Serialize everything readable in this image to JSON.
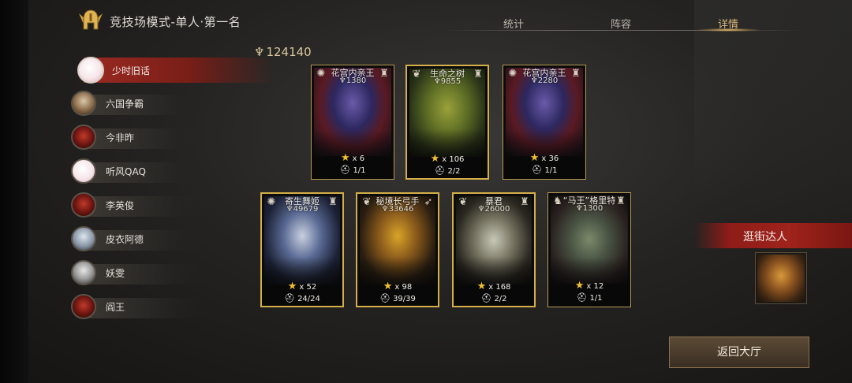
{
  "header": {
    "title": "竞技场模式-单人·第一名",
    "tabs": [
      {
        "label": "统计",
        "active": false
      },
      {
        "label": "阵容",
        "active": false
      },
      {
        "label": "详情",
        "active": true
      }
    ]
  },
  "players": [
    {
      "name": "少时旧话",
      "avatar": "blank-avatar",
      "selected": true
    },
    {
      "name": "六国争霸",
      "avatar": "king-avatar",
      "selected": false
    },
    {
      "name": "今非昨",
      "avatar": "demon-avatar",
      "selected": false
    },
    {
      "name": "听风QAQ",
      "avatar": "blank-avatar",
      "selected": false
    },
    {
      "name": "李英俊",
      "avatar": "demon-avatar",
      "selected": false
    },
    {
      "name": "皮衣阿德",
      "avatar": "pale-avatar",
      "selected": false
    },
    {
      "name": "妖雯",
      "avatar": "ghost-avatar",
      "selected": false
    },
    {
      "name": "阎王",
      "avatar": "demon-avatar",
      "selected": false
    }
  ],
  "lineup": {
    "total_power": "124140",
    "units": [
      {
        "name": "花宫内亲王",
        "power": "1380",
        "stars": "x 6",
        "count": "1/1",
        "art": "queen",
        "highlighted": false
      },
      {
        "name": "生命之树",
        "power": "9855",
        "stars": "x 106",
        "count": "2/2",
        "art": "tree",
        "highlighted": true
      },
      {
        "name": "花宫内亲王",
        "power": "2280",
        "stars": "x 36",
        "count": "1/1",
        "art": "queen",
        "highlighted": false
      },
      {
        "name": "寄生舞姬",
        "power": "49679",
        "stars": "x 52",
        "count": "24/24",
        "art": "dancer",
        "highlighted": true
      },
      {
        "name": "秘境长弓手",
        "power": "33646",
        "stars": "x 98",
        "count": "39/39",
        "art": "archer",
        "highlighted": true
      },
      {
        "name": "暴君",
        "power": "26000",
        "stars": "x 168",
        "count": "2/2",
        "art": "tyrant",
        "highlighted": true
      },
      {
        "name": "“马王”格里特",
        "power": "1300",
        "stars": "x 12",
        "count": "1/1",
        "art": "horse",
        "highlighted": false
      }
    ]
  },
  "sidebar_right": {
    "hero_label": "逛街达人",
    "hero_icon": "hero-portrait"
  },
  "footer": {
    "return_label": "返回大厅"
  },
  "colors": {
    "accent_gold": "#d4ae48",
    "ribbon_red": "#a0231c",
    "tab_active": "#d8b878"
  }
}
